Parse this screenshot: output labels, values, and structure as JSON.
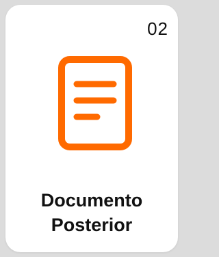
{
  "card": {
    "number": "02",
    "title_line1": "Documento",
    "title_line2": "Posterior",
    "icon": "document-icon",
    "accent_color": "#ff6a00"
  }
}
